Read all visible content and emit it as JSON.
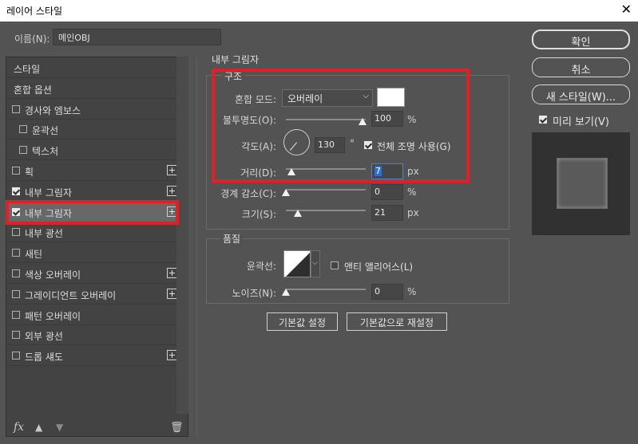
{
  "window": {
    "title": "레이어 스타일",
    "close_glyph": "✕"
  },
  "name_field": {
    "label": "이름(N):",
    "value": "메인OBJ"
  },
  "styles_list": [
    {
      "label": "스타일",
      "checkbox": false,
      "checked": false,
      "plus": false,
      "indent": false,
      "selected": false
    },
    {
      "label": "혼합 옵션",
      "checkbox": false,
      "checked": false,
      "plus": false,
      "indent": false,
      "selected": false
    },
    {
      "label": "경사와 엠보스",
      "checkbox": true,
      "checked": false,
      "plus": false,
      "indent": false,
      "selected": false
    },
    {
      "label": "윤곽선",
      "checkbox": true,
      "checked": false,
      "plus": false,
      "indent": true,
      "selected": false
    },
    {
      "label": "텍스처",
      "checkbox": true,
      "checked": false,
      "plus": false,
      "indent": true,
      "selected": false
    },
    {
      "label": "획",
      "checkbox": true,
      "checked": false,
      "plus": true,
      "indent": false,
      "selected": false
    },
    {
      "label": "내부 그림자",
      "checkbox": true,
      "checked": true,
      "plus": true,
      "indent": false,
      "selected": false
    },
    {
      "label": "내부 그림자",
      "checkbox": true,
      "checked": true,
      "plus": true,
      "indent": false,
      "selected": true
    },
    {
      "label": "내부 광선",
      "checkbox": true,
      "checked": false,
      "plus": false,
      "indent": false,
      "selected": false
    },
    {
      "label": "새틴",
      "checkbox": true,
      "checked": false,
      "plus": false,
      "indent": false,
      "selected": false
    },
    {
      "label": "색상 오버레이",
      "checkbox": true,
      "checked": false,
      "plus": true,
      "indent": false,
      "selected": false
    },
    {
      "label": "그레이디언트 오버레이",
      "checkbox": true,
      "checked": false,
      "plus": true,
      "indent": false,
      "selected": false
    },
    {
      "label": "패턴 오버레이",
      "checkbox": true,
      "checked": false,
      "plus": false,
      "indent": false,
      "selected": false
    },
    {
      "label": "외부 광선",
      "checkbox": true,
      "checked": false,
      "plus": false,
      "indent": false,
      "selected": false
    },
    {
      "label": "드롭 섀도",
      "checkbox": true,
      "checked": false,
      "plus": true,
      "indent": false,
      "selected": false
    }
  ],
  "bottom_icons": {
    "fx": "fx",
    "up": "▲",
    "down": "▼",
    "trash": "🗑"
  },
  "inner_shadow": {
    "title": "내부 그림자",
    "structure": {
      "title": "구조",
      "blend_mode_label": "혼합 모드:",
      "blend_mode_value": "오버레이",
      "blend_color": "#ffffff",
      "opacity_label": "불투명도(O):",
      "opacity_value": "100",
      "opacity_unit": "%",
      "opacity_fraction": 1.0,
      "angle_label": "각도(A):",
      "angle_value": "130",
      "angle_unit": "°",
      "global_light_label": "전체 조명 사용(G)",
      "global_light_checked": true,
      "distance_label": "거리(D):",
      "distance_value": "7",
      "distance_unit": "px",
      "choke_label": "경계 감소(C):",
      "choke_value": "0",
      "choke_unit": "%",
      "size_label": "크기(S):",
      "size_value": "21",
      "size_unit": "px"
    },
    "quality": {
      "title": "품질",
      "contour_label": "윤곽선:",
      "antialias_label": "앤티 앨리어스(L)",
      "antialias_checked": false,
      "noise_label": "노이즈(N):",
      "noise_value": "0",
      "noise_unit": "%"
    },
    "default_button": "기본값 설정",
    "reset_button": "기본값으로 재설정"
  },
  "right_panel": {
    "ok": "확인",
    "cancel": "취소",
    "new_style": "새 스타일(W)...",
    "preview_label": "미리 보기(V)",
    "preview_checked": true
  },
  "colors": {
    "highlight": "#e51d24",
    "panel_bg": "#535353"
  }
}
